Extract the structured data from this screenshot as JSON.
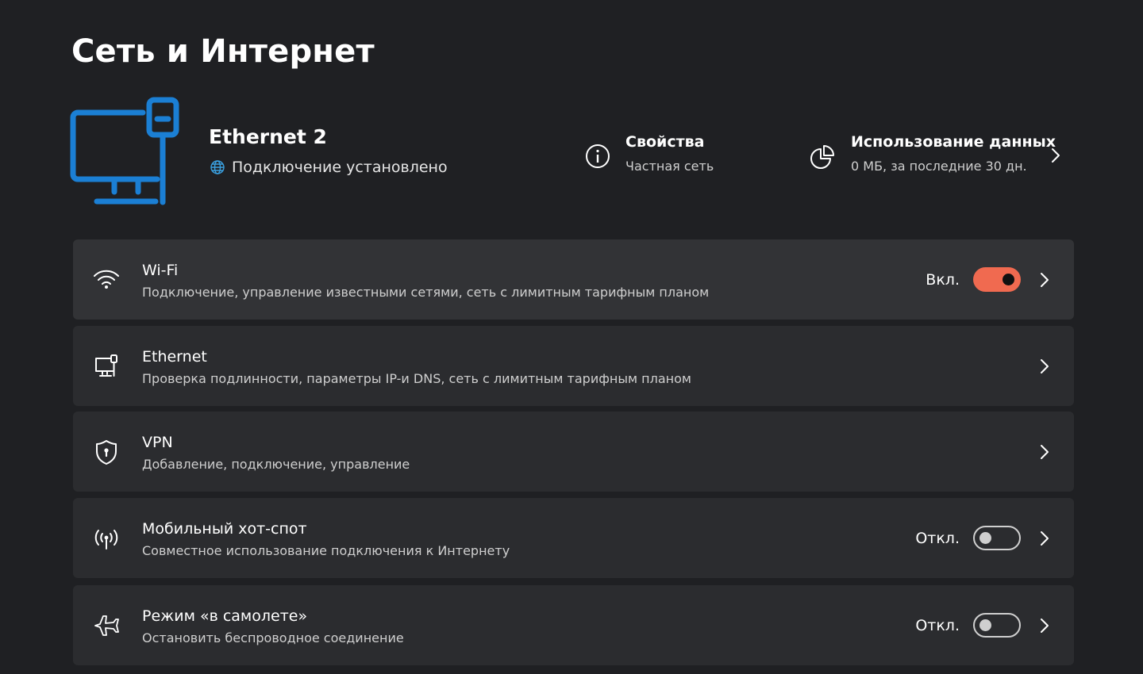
{
  "page": {
    "title": "Сеть и Интернет"
  },
  "header": {
    "connection_name": "Ethernet 2",
    "connection_status": "Подключение установлено",
    "properties": {
      "title": "Свойства",
      "subtitle": "Частная сеть"
    },
    "data_usage": {
      "title": "Использование данных",
      "subtitle": "0 МБ, за последние 30 дн."
    }
  },
  "colors": {
    "accent": "#f06a50",
    "hero_icon": "#1b7fd4",
    "background": "#1f2023",
    "card": "#2b2c2f"
  },
  "items": [
    {
      "title": "Wi-Fi",
      "subtitle": "Подключение, управление известными сетями, сеть с лимитным тарифным планом",
      "state": "Вкл.",
      "toggle": true,
      "icon": "wifi-icon"
    },
    {
      "title": "Ethernet",
      "subtitle": "Проверка подлинности, параметры IP-и DNS, сеть с лимитным тарифным планом",
      "icon": "ethernet-icon"
    },
    {
      "title": "VPN",
      "subtitle": "Добавление, подключение, управление",
      "icon": "shield-icon"
    },
    {
      "title": "Мобильный хот-спот",
      "subtitle": "Совместное использование подключения к Интернету",
      "state": "Откл.",
      "toggle": false,
      "icon": "hotspot-icon"
    },
    {
      "title": "Режим «в самолете»",
      "subtitle": "Остановить беспроводное соединение",
      "state": "Откл.",
      "toggle": false,
      "icon": "airplane-icon"
    }
  ]
}
